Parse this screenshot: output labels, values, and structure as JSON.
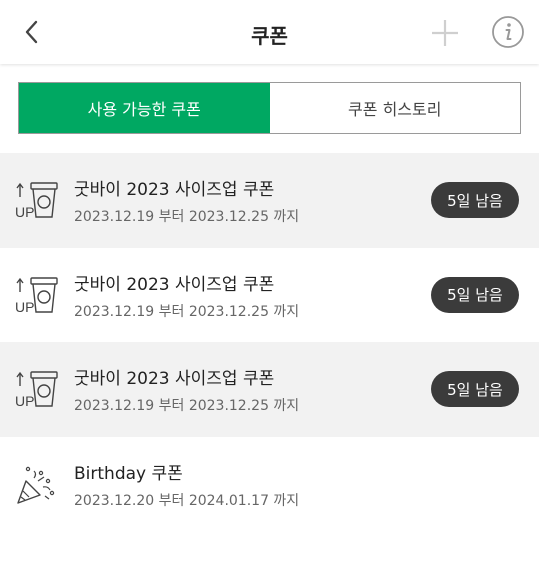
{
  "header": {
    "title": "쿠폰"
  },
  "tabs": [
    {
      "label": "사용 가능한 쿠폰",
      "active": true
    },
    {
      "label": "쿠폰 히스토리",
      "active": false
    }
  ],
  "colors": {
    "accent": "#00a862",
    "badge": "#3b3b3b",
    "row_shade": "#f2f2f2"
  },
  "coupons": [
    {
      "icon": "size-up-cup-icon",
      "name": "굿바이 2023 사이즈업 쿠폰",
      "dates": "2023.12.19 부터 2023.12.25 까지",
      "badge": "5일 남음"
    },
    {
      "icon": "size-up-cup-icon",
      "name": "굿바이 2023 사이즈업 쿠폰",
      "dates": "2023.12.19 부터 2023.12.25 까지",
      "badge": "5일 남음"
    },
    {
      "icon": "size-up-cup-icon",
      "name": "굿바이 2023 사이즈업 쿠폰",
      "dates": "2023.12.19 부터 2023.12.25 까지",
      "badge": "5일 남음"
    },
    {
      "icon": "party-popper-icon",
      "name": "Birthday 쿠폰",
      "dates": "2023.12.20 부터 2024.01.17 까지",
      "badge": ""
    }
  ]
}
